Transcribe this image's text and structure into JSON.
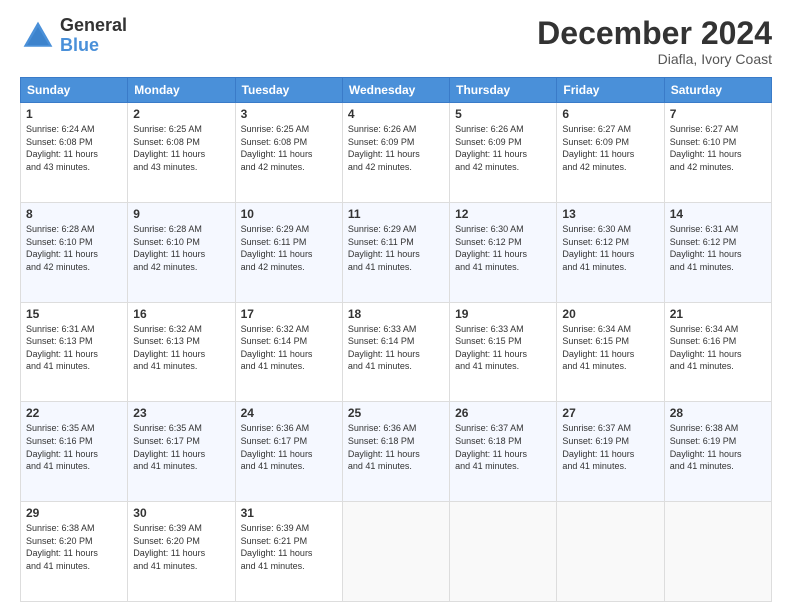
{
  "logo": {
    "general": "General",
    "blue": "Blue"
  },
  "title": "December 2024",
  "location": "Diafla, Ivory Coast",
  "days_header": [
    "Sunday",
    "Monday",
    "Tuesday",
    "Wednesday",
    "Thursday",
    "Friday",
    "Saturday"
  ],
  "weeks": [
    [
      {
        "day": "1",
        "info": "Sunrise: 6:24 AM\nSunset: 6:08 PM\nDaylight: 11 hours\nand 43 minutes."
      },
      {
        "day": "2",
        "info": "Sunrise: 6:25 AM\nSunset: 6:08 PM\nDaylight: 11 hours\nand 43 minutes."
      },
      {
        "day": "3",
        "info": "Sunrise: 6:25 AM\nSunset: 6:08 PM\nDaylight: 11 hours\nand 42 minutes."
      },
      {
        "day": "4",
        "info": "Sunrise: 6:26 AM\nSunset: 6:09 PM\nDaylight: 11 hours\nand 42 minutes."
      },
      {
        "day": "5",
        "info": "Sunrise: 6:26 AM\nSunset: 6:09 PM\nDaylight: 11 hours\nand 42 minutes."
      },
      {
        "day": "6",
        "info": "Sunrise: 6:27 AM\nSunset: 6:09 PM\nDaylight: 11 hours\nand 42 minutes."
      },
      {
        "day": "7",
        "info": "Sunrise: 6:27 AM\nSunset: 6:10 PM\nDaylight: 11 hours\nand 42 minutes."
      }
    ],
    [
      {
        "day": "8",
        "info": "Sunrise: 6:28 AM\nSunset: 6:10 PM\nDaylight: 11 hours\nand 42 minutes."
      },
      {
        "day": "9",
        "info": "Sunrise: 6:28 AM\nSunset: 6:10 PM\nDaylight: 11 hours\nand 42 minutes."
      },
      {
        "day": "10",
        "info": "Sunrise: 6:29 AM\nSunset: 6:11 PM\nDaylight: 11 hours\nand 42 minutes."
      },
      {
        "day": "11",
        "info": "Sunrise: 6:29 AM\nSunset: 6:11 PM\nDaylight: 11 hours\nand 41 minutes."
      },
      {
        "day": "12",
        "info": "Sunrise: 6:30 AM\nSunset: 6:12 PM\nDaylight: 11 hours\nand 41 minutes."
      },
      {
        "day": "13",
        "info": "Sunrise: 6:30 AM\nSunset: 6:12 PM\nDaylight: 11 hours\nand 41 minutes."
      },
      {
        "day": "14",
        "info": "Sunrise: 6:31 AM\nSunset: 6:12 PM\nDaylight: 11 hours\nand 41 minutes."
      }
    ],
    [
      {
        "day": "15",
        "info": "Sunrise: 6:31 AM\nSunset: 6:13 PM\nDaylight: 11 hours\nand 41 minutes."
      },
      {
        "day": "16",
        "info": "Sunrise: 6:32 AM\nSunset: 6:13 PM\nDaylight: 11 hours\nand 41 minutes."
      },
      {
        "day": "17",
        "info": "Sunrise: 6:32 AM\nSunset: 6:14 PM\nDaylight: 11 hours\nand 41 minutes."
      },
      {
        "day": "18",
        "info": "Sunrise: 6:33 AM\nSunset: 6:14 PM\nDaylight: 11 hours\nand 41 minutes."
      },
      {
        "day": "19",
        "info": "Sunrise: 6:33 AM\nSunset: 6:15 PM\nDaylight: 11 hours\nand 41 minutes."
      },
      {
        "day": "20",
        "info": "Sunrise: 6:34 AM\nSunset: 6:15 PM\nDaylight: 11 hours\nand 41 minutes."
      },
      {
        "day": "21",
        "info": "Sunrise: 6:34 AM\nSunset: 6:16 PM\nDaylight: 11 hours\nand 41 minutes."
      }
    ],
    [
      {
        "day": "22",
        "info": "Sunrise: 6:35 AM\nSunset: 6:16 PM\nDaylight: 11 hours\nand 41 minutes."
      },
      {
        "day": "23",
        "info": "Sunrise: 6:35 AM\nSunset: 6:17 PM\nDaylight: 11 hours\nand 41 minutes."
      },
      {
        "day": "24",
        "info": "Sunrise: 6:36 AM\nSunset: 6:17 PM\nDaylight: 11 hours\nand 41 minutes."
      },
      {
        "day": "25",
        "info": "Sunrise: 6:36 AM\nSunset: 6:18 PM\nDaylight: 11 hours\nand 41 minutes."
      },
      {
        "day": "26",
        "info": "Sunrise: 6:37 AM\nSunset: 6:18 PM\nDaylight: 11 hours\nand 41 minutes."
      },
      {
        "day": "27",
        "info": "Sunrise: 6:37 AM\nSunset: 6:19 PM\nDaylight: 11 hours\nand 41 minutes."
      },
      {
        "day": "28",
        "info": "Sunrise: 6:38 AM\nSunset: 6:19 PM\nDaylight: 11 hours\nand 41 minutes."
      }
    ],
    [
      {
        "day": "29",
        "info": "Sunrise: 6:38 AM\nSunset: 6:20 PM\nDaylight: 11 hours\nand 41 minutes."
      },
      {
        "day": "30",
        "info": "Sunrise: 6:39 AM\nSunset: 6:20 PM\nDaylight: 11 hours\nand 41 minutes."
      },
      {
        "day": "31",
        "info": "Sunrise: 6:39 AM\nSunset: 6:21 PM\nDaylight: 11 hours\nand 41 minutes."
      },
      {
        "day": "",
        "info": ""
      },
      {
        "day": "",
        "info": ""
      },
      {
        "day": "",
        "info": ""
      },
      {
        "day": "",
        "info": ""
      }
    ]
  ]
}
